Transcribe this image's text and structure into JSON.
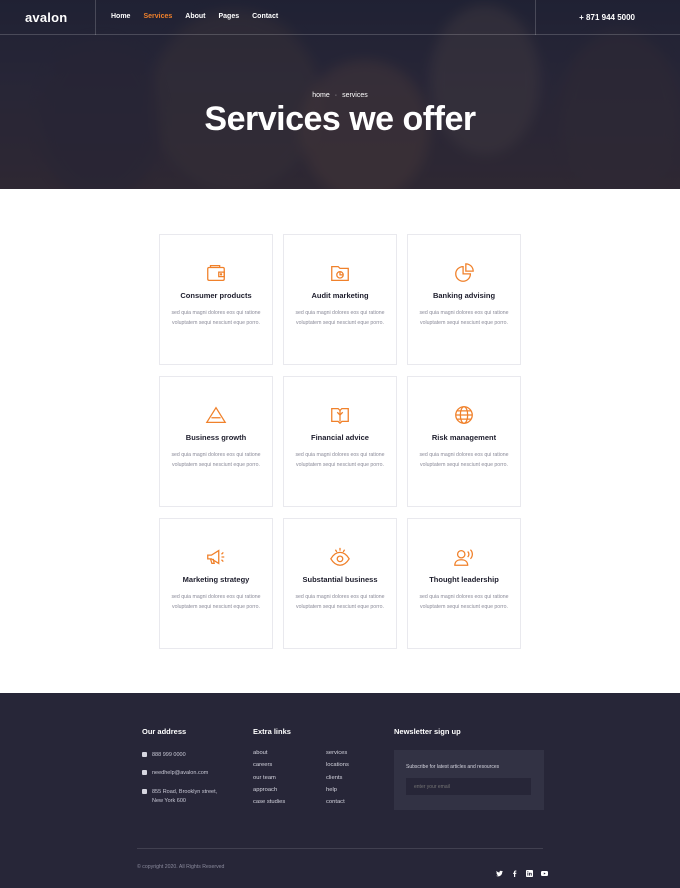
{
  "brand": {
    "logo": "avalon",
    "accent": "#f0812b",
    "dark": "#272638"
  },
  "nav": {
    "items": [
      {
        "label": "Home",
        "active": false
      },
      {
        "label": "Services",
        "active": true
      },
      {
        "label": "About",
        "active": false
      },
      {
        "label": "Pages",
        "active": false
      },
      {
        "label": "Contact",
        "active": false
      }
    ],
    "phone": "+ 871 944 5000"
  },
  "hero": {
    "breadcrumb": {
      "home": "home",
      "current": "services"
    },
    "title": "Services we offer"
  },
  "services": [
    {
      "title": "Consumer products",
      "desc": "sed quia magni dolores eos qui ratione voluptatem sequi nesciunt eque porro.",
      "icon": "wallet-icon"
    },
    {
      "title": "Audit marketing",
      "desc": "sed quia magni dolores eos qui ratione voluptatem sequi nesciunt eque porro.",
      "icon": "folder-chart-icon"
    },
    {
      "title": "Banking advising",
      "desc": "sed quia magni dolores eos qui ratione voluptatem sequi nesciunt eque porro.",
      "icon": "pie-chart-icon"
    },
    {
      "title": "Business growth",
      "desc": "sed quia magni dolores eos qui ratione voluptatem sequi nesciunt eque porro.",
      "icon": "triangle-icon"
    },
    {
      "title": "Financial advice",
      "desc": "sed quia magni dolores eos qui ratione voluptatem sequi nesciunt eque porro.",
      "icon": "book-icon"
    },
    {
      "title": "Risk management",
      "desc": "sed quia magni dolores eos qui ratione voluptatem sequi nesciunt eque porro.",
      "icon": "globe-icon"
    },
    {
      "title": "Marketing strategy",
      "desc": "sed quia magni dolores eos qui ratione voluptatem sequi nesciunt eque porro.",
      "icon": "megaphone-icon"
    },
    {
      "title": "Substantial business",
      "desc": "sed quia magni dolores eos qui ratione voluptatem sequi nesciunt eque porro.",
      "icon": "eye-icon"
    },
    {
      "title": "Thought leadership",
      "desc": "sed quia magni dolores eos qui ratione voluptatem sequi nesciunt eque porro.",
      "icon": "speaker-person-icon"
    }
  ],
  "footer": {
    "address": {
      "heading": "Our address",
      "phone": "888 999 0000",
      "email": "needhelp@avalon.com",
      "street": "855 Road, Brooklyn street,",
      "city": "New York 600"
    },
    "links": {
      "heading": "Extra links",
      "col1": [
        "about",
        "careers",
        "our team",
        "approach",
        "case studies"
      ],
      "col2": [
        "services",
        "locations",
        "clients",
        "help",
        "contact"
      ]
    },
    "newsletter": {
      "heading": "Newsletter sign up",
      "label": "Subscribe for latest articles and resources",
      "placeholder": "enter your email"
    },
    "copyright": "© copyright 2020. All Rights Reserved",
    "social": [
      "twitter-icon",
      "facebook-icon",
      "linkedin-icon",
      "youtube-icon"
    ]
  }
}
